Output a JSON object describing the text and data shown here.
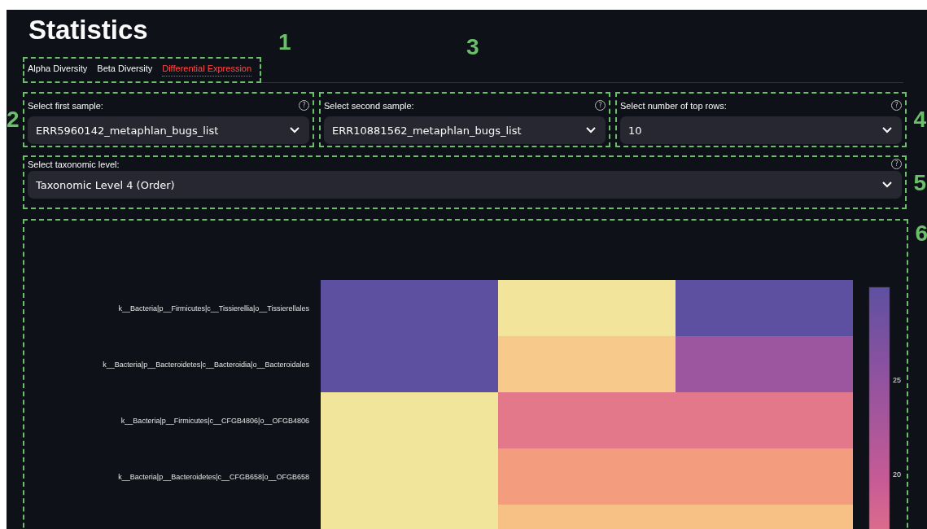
{
  "title": "Statistics",
  "tabs_annotation": "1",
  "tabs": [
    {
      "label": "Alpha Diversity",
      "selected": false
    },
    {
      "label": "Beta Diversity",
      "selected": false
    },
    {
      "label": "Differential Expression",
      "selected": true
    }
  ],
  "divider_annotation": "3",
  "selects": [
    {
      "annotation": "2",
      "label": "Select first sample:",
      "help": "?",
      "value": "ERR5960142_metaphlan_bugs_list"
    },
    {
      "label": "Select second sample:",
      "help": "?",
      "value": "ERR10881562_metaphlan_bugs_list"
    },
    {
      "annotation": "4",
      "label": "Select number of top rows:",
      "help": "?",
      "value": "10"
    }
  ],
  "taxonomic": {
    "annotation": "5",
    "label": "Select taxonomic level:",
    "help": "?",
    "value": "Taxonomic Level 4 (Order)"
  },
  "heatmap": {
    "annotation": "6",
    "rows": [
      {
        "label": "k__Bacteria|p__Firmicutes|c__Tissierellia|o__Tissierellales",
        "cells": [
          {
            "color": "#5e50a1"
          },
          {
            "color": "#f2e59b"
          },
          {
            "color": "#5e50a1"
          }
        ]
      },
      {
        "label": "k__Bacteria|p__Bacteroidetes|c__Bacteroidia|o__Bacteroidales",
        "cells": [
          {
            "color": "#5e50a1"
          },
          {
            "color": "#f7c98a"
          },
          {
            "color": "#9b569f"
          }
        ]
      },
      {
        "label": "k__Bacteria|p__Firmicutes|c__CFGB4806|o__OFGB4806",
        "cells": [
          {
            "color": "#f1e49b"
          },
          {
            "color": "#e2788a"
          },
          {
            "color": "#e2788a"
          }
        ]
      },
      {
        "label": "k__Bacteria|p__Bacteroidetes|c__CFGB658|o__OFGB658",
        "cells": [
          {
            "color": "#f1e49b"
          },
          {
            "color": "#f39c7e"
          },
          {
            "color": "#f39c7e"
          }
        ]
      },
      {
        "cells": [
          {
            "color": "#f1e49b"
          },
          {
            "color": "#f7c085"
          },
          {
            "color": "#f7c085"
          }
        ]
      }
    ],
    "colorbar_ticks": [
      "25",
      "20"
    ]
  }
}
